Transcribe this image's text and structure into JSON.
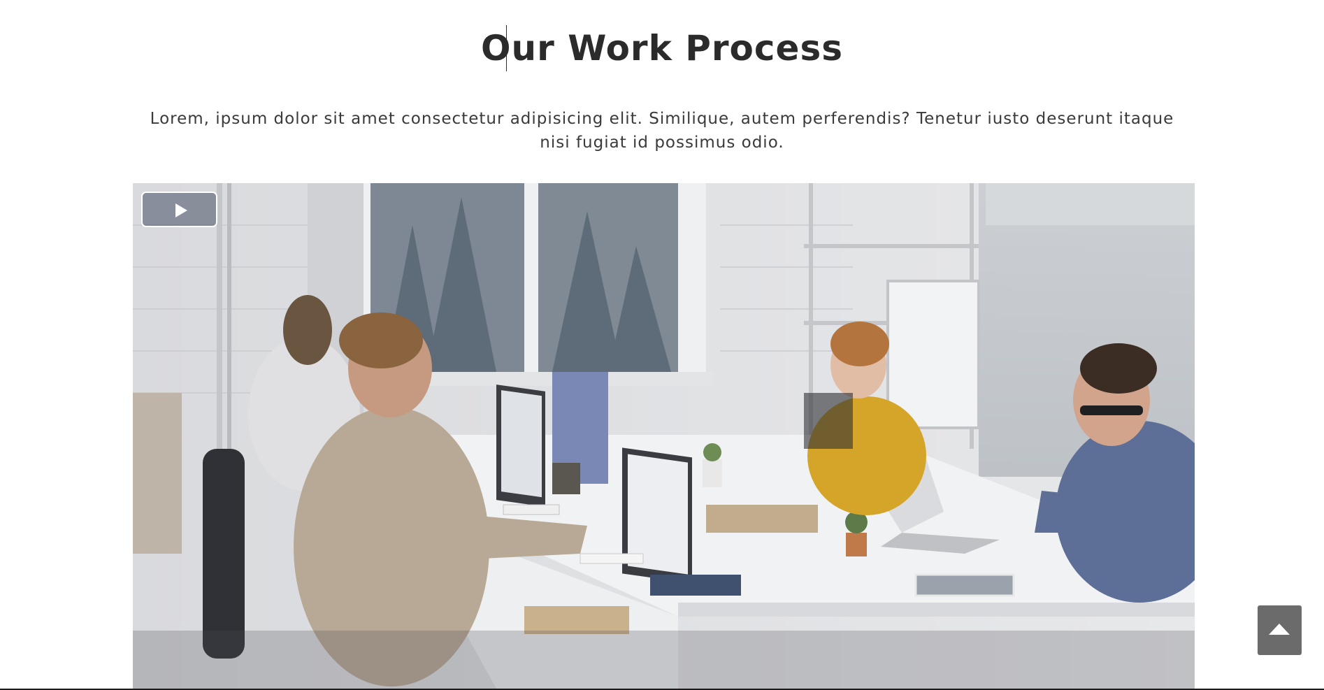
{
  "section": {
    "title": "Our Work Process",
    "description": "Lorem, ipsum dolor sit amet consectetur adipisicing elit. Similique, autem perferendis? Tenetur iusto deserunt itaque nisi fugiat id possimus odio."
  },
  "video": {
    "play_icon": "play-icon"
  },
  "back_to_top": {
    "icon": "arrow-up-icon"
  },
  "colors": {
    "title": "#2b2b2b",
    "text": "#3a3a3a",
    "back_to_top_bg": "#6b6b6b"
  }
}
